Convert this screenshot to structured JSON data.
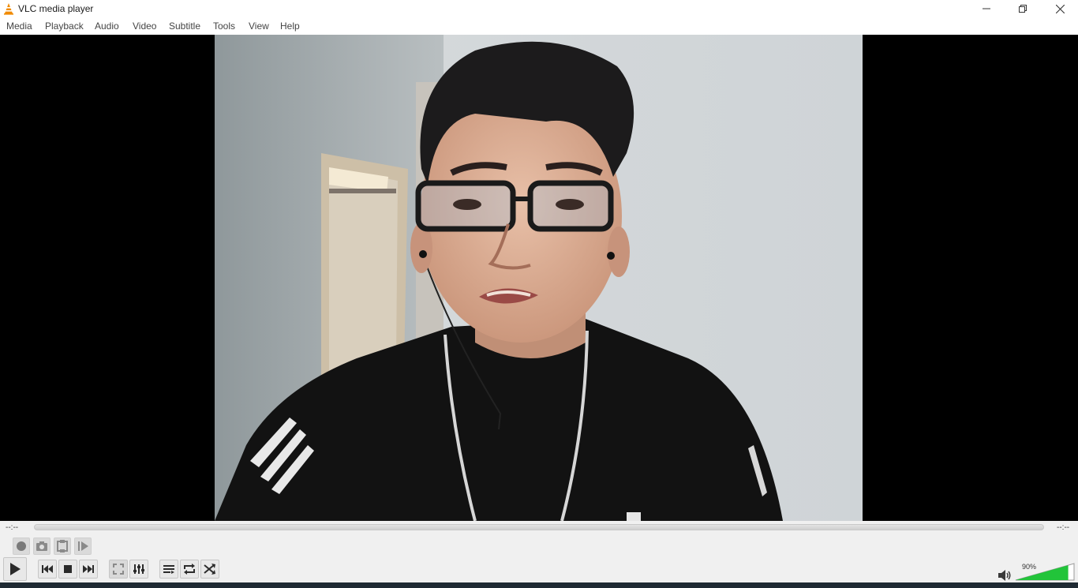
{
  "window": {
    "title": "VLC media player",
    "controls": {
      "minimize": "minimize-icon",
      "restore": "restore-icon",
      "close": "close-icon"
    }
  },
  "menu": [
    "Media",
    "Playback",
    "Audio",
    "Video",
    "Subtitle",
    "Tools",
    "View",
    "Help"
  ],
  "player": {
    "time_elapsed": "--:--",
    "time_remaining": "--:--",
    "volume_label": "90%",
    "volume_level": 0.9,
    "seek_position": 0
  },
  "advanced_buttons": [
    "record-icon",
    "snapshot-icon",
    "loop-ab-icon",
    "frame-step-icon"
  ],
  "main_buttons": [
    "play-icon",
    "previous-icon",
    "stop-icon",
    "next-icon",
    "fullscreen-icon",
    "extended-settings-icon",
    "playlist-icon",
    "loop-icon",
    "shuffle-icon"
  ],
  "colors": {
    "vlc_orange": "#f08a00",
    "volume_green": "#22c43a",
    "video_background": "#000000",
    "controls_background": "#f0f0f0"
  }
}
